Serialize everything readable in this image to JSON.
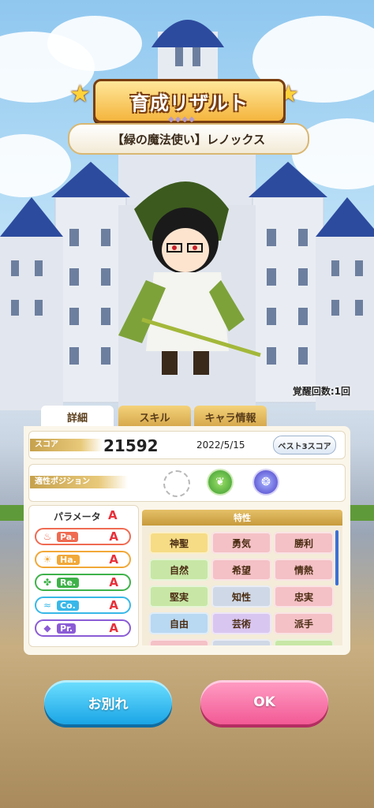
{
  "header": {
    "title": "育成リザルト",
    "character_name": "【緑の魔法使い】レノックス",
    "awaken_count": "覚醒回数:1回"
  },
  "tabs": [
    {
      "label": "詳細",
      "active": true
    },
    {
      "label": "スキル",
      "active": false
    },
    {
      "label": "キャラ情報",
      "active": false
    }
  ],
  "score": {
    "label": "スコア",
    "value": "21592",
    "date": "2022/5/15",
    "best3_label": "ベスト3スコア"
  },
  "position": {
    "label": "適性ポジション",
    "icons": [
      "empty-circle-icon",
      "leaf-orb-icon",
      "wave-orb-icon"
    ]
  },
  "parameters": {
    "title": "パラメータ",
    "overall_rank": "A",
    "items": [
      {
        "label": "Pa.",
        "rank": "A",
        "icon": "flame-icon",
        "color": "#ef6b52"
      },
      {
        "label": "Ha.",
        "rank": "A",
        "icon": "sun-icon",
        "color": "#f1a838"
      },
      {
        "label": "Re.",
        "rank": "A",
        "icon": "clover-icon",
        "color": "#3fb24a"
      },
      {
        "label": "Co.",
        "rank": "A",
        "icon": "wave-icon",
        "color": "#38b8e8"
      },
      {
        "label": "Pr.",
        "rank": "A",
        "icon": "gem-icon",
        "color": "#8b5cd6"
      }
    ]
  },
  "traits": {
    "title": "特性",
    "items": [
      {
        "label": "神聖",
        "color": "#f6dc85"
      },
      {
        "label": "勇気",
        "color": "#f4c1c6"
      },
      {
        "label": "勝利",
        "color": "#f4c1c6"
      },
      {
        "label": "自然",
        "color": "#c8e7a6"
      },
      {
        "label": "希望",
        "color": "#f4c1c6"
      },
      {
        "label": "情熱",
        "color": "#f4c1c6"
      },
      {
        "label": "堅実",
        "color": "#c8e7a6"
      },
      {
        "label": "知性",
        "color": "#cfd8e6"
      },
      {
        "label": "忠実",
        "color": "#f4c1c6"
      },
      {
        "label": "自由",
        "color": "#b9d8f2"
      },
      {
        "label": "芸術",
        "color": "#d9c6f0"
      },
      {
        "label": "派手",
        "color": "#f4c1c6"
      }
    ]
  },
  "buttons": {
    "farewell": "お別れ",
    "ok": "OK"
  }
}
